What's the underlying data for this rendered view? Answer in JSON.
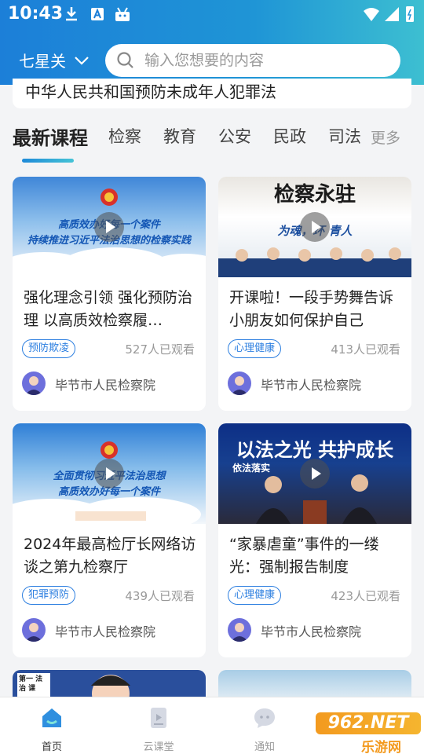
{
  "status_bar": {
    "time": "10:43"
  },
  "header": {
    "city": "七星关",
    "search_placeholder": "输入您想要的内容"
  },
  "notice": {
    "text": "中华人民共和国预防未成年人犯罪法"
  },
  "tabs": [
    {
      "label": "最新课程",
      "active": true
    },
    {
      "label": "检察",
      "active": false
    },
    {
      "label": "教育",
      "active": false
    },
    {
      "label": "公安",
      "active": false
    },
    {
      "label": "民政",
      "active": false
    },
    {
      "label": "司法",
      "active": false
    }
  ],
  "tabs_more": "更多",
  "courses": [
    {
      "thumb_text_1": "高质效办好每一个案件",
      "thumb_text_2": "持续推进习近平法治思想的检察实践",
      "title": "强化理念引领 强化预防治理 以高质效检察履…",
      "tag": "预防欺凌",
      "views": "527人已观看",
      "author": "毕节市人民检察院"
    },
    {
      "thumb_text_1": "检察永驻",
      "thumb_text_2": "为魂，环 青人",
      "title": "开课啦！一段手势舞告诉小朋友如何保护自己",
      "tag": "心理健康",
      "views": "413人已观看",
      "author": "毕节市人民检察院"
    },
    {
      "thumb_text_1": "全面贯彻习近平法治思想",
      "thumb_text_2": "高质效办好每一个案件",
      "title": "2024年最高检厅长网络访谈之第九检察厅",
      "tag": "犯罪预防",
      "views": "439人已观看",
      "author": "毕节市人民检察院"
    },
    {
      "thumb_text_1": "以法之光 共护成长",
      "thumb_text_2": "依法落实",
      "title": "“家暴虐童”事件的一缕光：强制报告制度",
      "tag": "心理健康",
      "views": "423人已观看",
      "author": "毕节市人民检察院"
    }
  ],
  "partial_card": {
    "thumb_text": "第一 法治 课"
  },
  "tabbar": [
    {
      "label": "首页",
      "icon": "home-icon",
      "active": true
    },
    {
      "label": "云课堂",
      "icon": "video-icon",
      "active": false
    },
    {
      "label": "通知",
      "icon": "chat-icon",
      "active": false
    }
  ],
  "watermark": {
    "top": "962.NET",
    "bottom": "乐游网"
  },
  "colors": {
    "header_start": "#1c7fd8",
    "header_end": "#3dbfd1",
    "accent": "#2d7fe0",
    "background": "#f3f4f6"
  }
}
